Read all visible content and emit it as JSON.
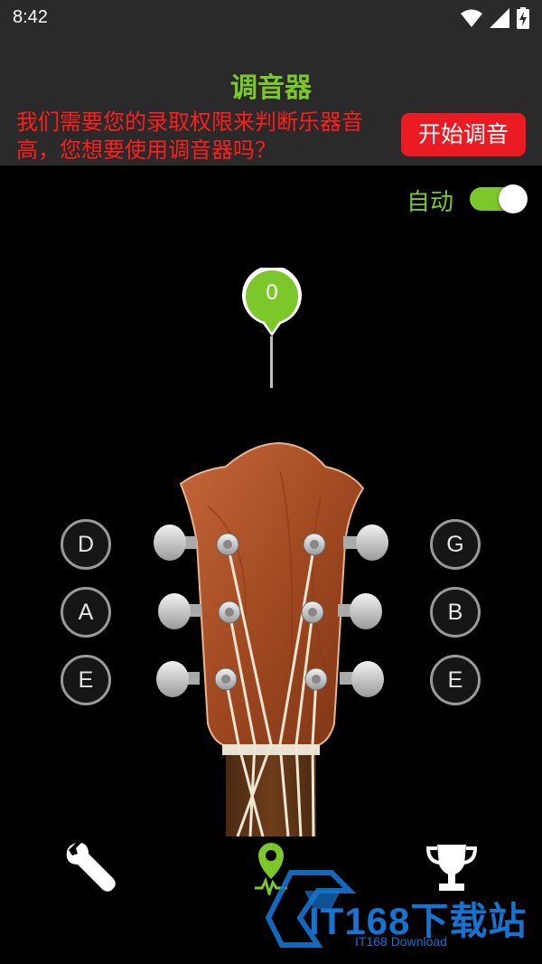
{
  "status_bar": {
    "time": "8:42"
  },
  "header": {
    "title": "调音器",
    "permission_text": "我们需要您的录取权限来判断乐器音高，您想要使用调音器吗？",
    "start_button": "开始调音"
  },
  "auto_mode": {
    "label": "自动",
    "enabled": true
  },
  "tuner": {
    "value": "0"
  },
  "strings": {
    "left": [
      "D",
      "A",
      "E"
    ],
    "right": [
      "G",
      "B",
      "E"
    ]
  },
  "bottom_nav": {
    "items": [
      {
        "icon": "wrench-icon"
      },
      {
        "icon": "tuner-pin-icon",
        "active": true
      },
      {
        "icon": "trophy-icon"
      }
    ]
  },
  "watermark": {
    "text": "IT168下载站",
    "sub": "IT168 Download"
  },
  "colors": {
    "accent": "#7cc72a",
    "alert": "#ff1e1e",
    "button": "#ea1b22",
    "watermark": "#1673cf"
  }
}
